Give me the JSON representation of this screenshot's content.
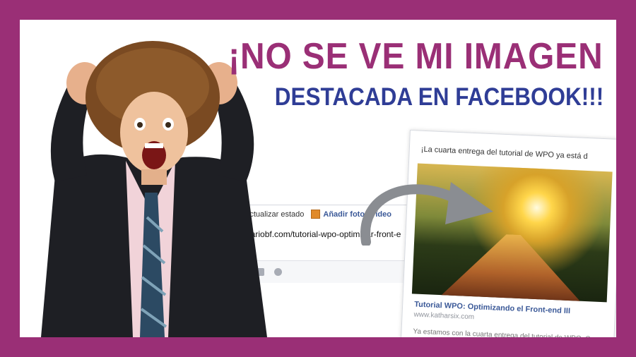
{
  "headline": {
    "line1": "¡NO SE VE MI IMAGEN",
    "line2": "DESTACADA EN FACEBOOK!!!"
  },
  "composer": {
    "status_tab": "Actualizar estado",
    "photo_tab": "Añadir fotos/vídeo",
    "url": "http://dariobf.com/tutorial-wpo-optimizar-front-e"
  },
  "preview": {
    "post_text": "¡La cuarta entrega del tutorial de WPO ya está d",
    "link_title": "Tutorial WPO: Optimizando el Front-end III",
    "domain": "www.katharsix.com",
    "description": "Ya estamos con la cuarta entrega del tutorial de WPO. Con sobre externalizar ficheros y el..."
  },
  "colors": {
    "frame": "#9a2f76",
    "headline1": "#9a2f76",
    "headline2": "#2f3d96",
    "facebook_link": "#3b5998"
  },
  "icons": [
    "photo-icon",
    "location-icon",
    "camera-icon",
    "emoji-icon",
    "curved-arrow-icon"
  ]
}
